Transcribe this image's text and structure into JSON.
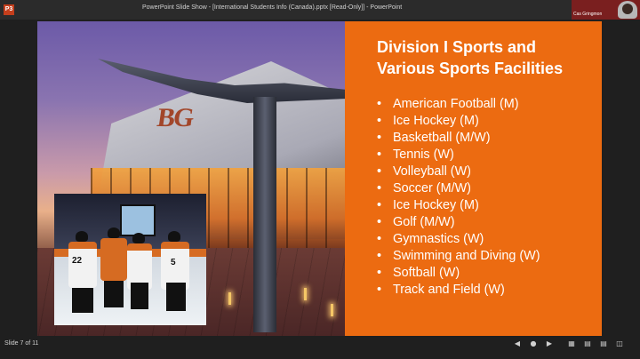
{
  "window": {
    "title": "PowerPoint Slide Show - [International Students Info (Canada).pptx [Read-Only]] - PowerPoint",
    "app_icon_label": "P3"
  },
  "webcam": {
    "name": "Cas Gringmon"
  },
  "slide": {
    "title_line1": "Division I Sports and",
    "title_line2": "Various Sports Facilities",
    "items": [
      "American Football (M)",
      "Ice Hockey (M)",
      "Basketball (M/W)",
      "Tennis (W)",
      "Volleyball (W)",
      "Soccer (M/W)",
      "Ice Hockey  (M)",
      "Golf (M/W)",
      "Gymnastics (W)",
      "Swimming and Diving (W)",
      "Softball (W)",
      "Track and Field (W)"
    ],
    "photo_logo": "BG",
    "player_numbers": [
      "22",
      "5"
    ]
  },
  "status": {
    "slide_indicator": "Slide 7 of 11"
  },
  "controls": [
    "previous-icon",
    "menu-icon",
    "next-icon",
    "grid-icon",
    "notes-icon",
    "reading-view-icon",
    "slideshow-icon"
  ],
  "colors": {
    "panel": "#ec6b11",
    "text": "#ffffff",
    "chrome": "#2b2b2b"
  }
}
